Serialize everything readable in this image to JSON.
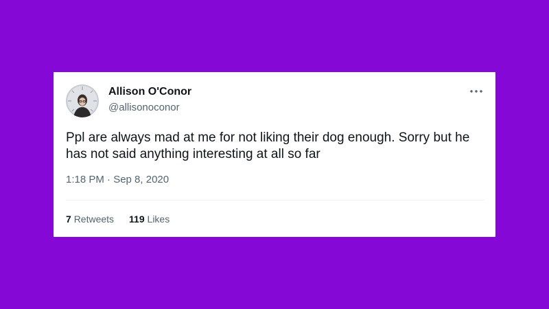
{
  "tweet": {
    "author": {
      "display_name": "Allison O'Conor",
      "handle": "@allisonoconor"
    },
    "text": "Ppl are always mad at me for not liking their dog enough. Sorry but he has not said anything interesting at all so far",
    "timestamp": "1:18 PM · Sep 8, 2020",
    "retweets": {
      "count": "7",
      "label": "Retweets"
    },
    "likes": {
      "count": "119",
      "label": "Likes"
    }
  },
  "icons": {
    "more": "more-icon"
  },
  "colors": {
    "background": "#8508d6",
    "card": "#ffffff",
    "text_primary": "#0f1419",
    "text_secondary": "#536471"
  }
}
